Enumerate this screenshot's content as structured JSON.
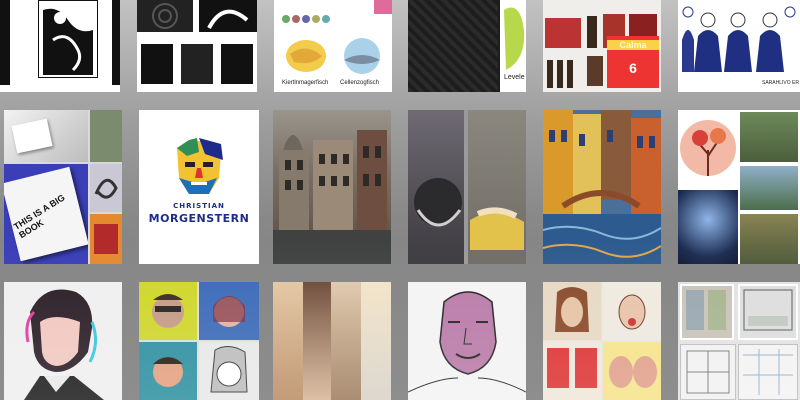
{
  "gallery": {
    "colors": {
      "background_top": "#c2c2c2",
      "background_bottom": "#7a7a7a",
      "logo_navy": "#1d2b8c",
      "accent_red": "#d33"
    },
    "row1": {
      "tiles": [
        {
          "name": "ink-illustrations",
          "icon": "image-icon"
        },
        {
          "name": "black-white-prints",
          "icon": "image-icon"
        },
        {
          "name": "fish-illustrations",
          "captions": [
            "Kiertlnmagerfisch",
            "Cellenzogfisch"
          ]
        },
        {
          "name": "pattern-branding",
          "caption": "Levele"
        },
        {
          "name": "beer-packaging",
          "label": "Calma",
          "label_sub": "6"
        },
        {
          "name": "folk-figures",
          "caption": "SARAHLIVO ER"
        }
      ]
    },
    "row2": {
      "tiles": [
        {
          "name": "book-design",
          "cover_title": "THIS IS A BIG BOOK"
        },
        {
          "name": "morgenstern-logo",
          "logo_line1": "CHRISTIAN",
          "logo_line2": "MORGENSTERN"
        },
        {
          "name": "venice-painting"
        },
        {
          "name": "abstract-diptych"
        },
        {
          "name": "venice-canal-painting"
        },
        {
          "name": "landscape-paintings"
        }
      ]
    },
    "row3": {
      "tiles": [
        {
          "name": "neon-portrait"
        },
        {
          "name": "popart-portraits"
        },
        {
          "name": "split-faces"
        },
        {
          "name": "line-portrait"
        },
        {
          "name": "expression-portraits"
        },
        {
          "name": "window-sketches"
        }
      ]
    }
  }
}
